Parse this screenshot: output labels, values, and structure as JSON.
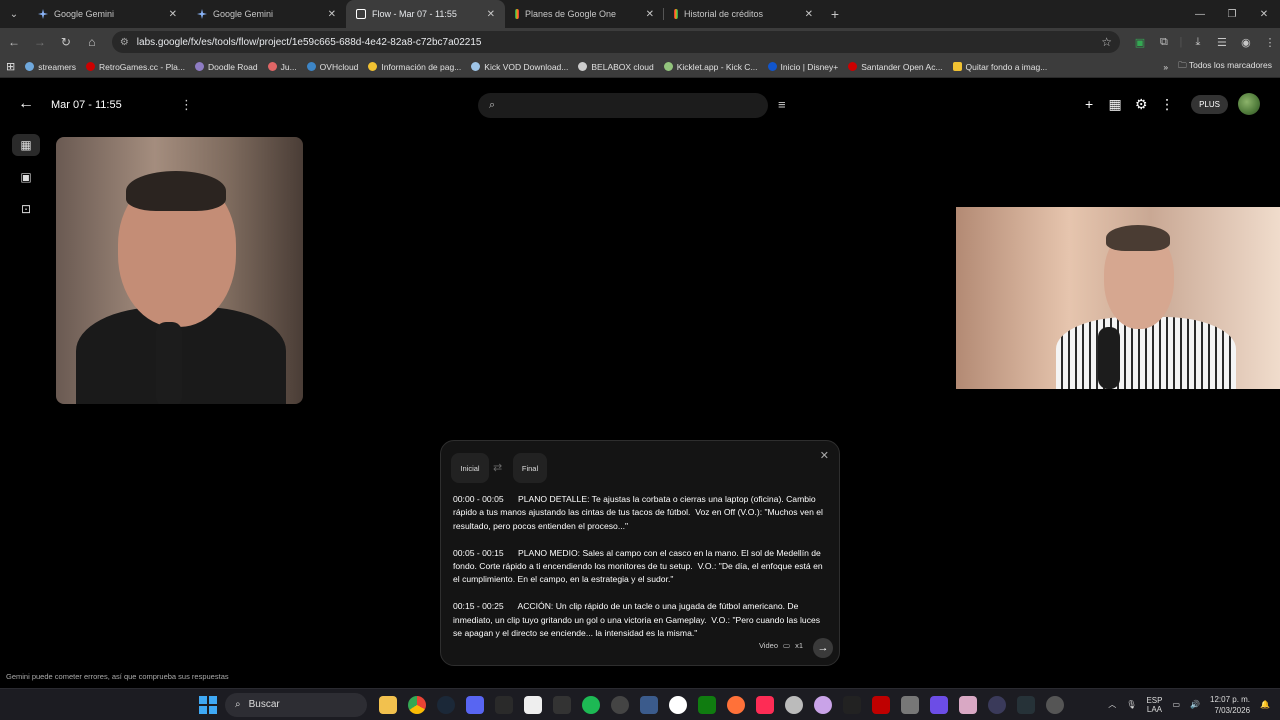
{
  "browser": {
    "tabs": [
      {
        "title": "Google Gemini",
        "active": false,
        "favicon_color": "#8ab4f8"
      },
      {
        "title": "Google Gemini",
        "active": false,
        "favicon_color": "#8ab4f8"
      },
      {
        "title": "Flow - Mar 07 - 11:55",
        "active": true,
        "favicon_color": "#ffffff"
      },
      {
        "title": "Planes de Google One",
        "active": false,
        "favicon_color": "#34a853"
      },
      {
        "title": "Historial de créditos",
        "active": false,
        "favicon_color": "#ea4335"
      }
    ],
    "url": "labs.google/fx/es/tools/flow/project/1e59c665-688d-4e42-82a8-c72bc7a02215",
    "bookmarks": [
      {
        "label": "streamers",
        "color": "#6fa8dc"
      },
      {
        "label": "RetroGames.cc - Pla...",
        "color": "#cc0000"
      },
      {
        "label": "Doodle Road",
        "color": "#8e7cc3"
      },
      {
        "label": "Ju...",
        "color": "#e06666"
      },
      {
        "label": "OVHcloud",
        "color": "#3d85c6"
      },
      {
        "label": "Información de pag...",
        "color": "#f1c232"
      },
      {
        "label": "Kick VOD Download...",
        "color": "#9fc5e8"
      },
      {
        "label": "BELABOX cloud",
        "color": "#cccccc"
      },
      {
        "label": "Kicklet.app - Kick C...",
        "color": "#93c47d"
      },
      {
        "label": "Inicio | Disney+",
        "color": "#1155cc"
      },
      {
        "label": "Santander Open Ac...",
        "color": "#cc0000"
      },
      {
        "label": "Quitar fondo a imag...",
        "color": "#f1c232"
      }
    ],
    "all_bookmarks": "Todos los marcadores"
  },
  "app": {
    "project_title": "Mar 07 - 11:55",
    "plan_badge": "PLUS"
  },
  "panel": {
    "start_label": "Inicial",
    "end_label": "Final",
    "paragraphs": [
      "00:00 - 00:05      PLANO DETALLE: Te ajustas la corbata o cierras una laptop (oficina). Cambio rápido a tus manos ajustando las cintas de tus tacos de fútbol.  Voz en Off (V.O.): \"Muchos ven el resultado, pero pocos entienden el proceso...\"",
      "00:05 - 00:15      PLANO MEDIO: Sales al campo con el casco en la mano. El sol de Medellín de fondo. Corte rápido a ti encendiendo los monitores de tu setup.  V.O.: \"De día, el enfoque está en el cumplimiento. En el campo, en la estrategia y el sudor.\"",
      "00:15 - 00:25      ACCIÓN: Un clip rápido de un tacle o una jugada de fútbol americano. De inmediato, un clip tuyo gritando un gol o una victoria en Gameplay.  V.O.: \"Pero cuando las luces se apagan y el directo se enciende... la intensidad es la misma.\""
    ],
    "mode_label": "Video",
    "count_label": "x1"
  },
  "disclaimer": "Gemini puede cometer errores, así que comprueba sus respuestas",
  "taskbar": {
    "search_label": "Buscar",
    "lang_line1": "ESP",
    "lang_line2": "LAA",
    "time": "12:07 p. m.",
    "date": "7/03/2026"
  }
}
